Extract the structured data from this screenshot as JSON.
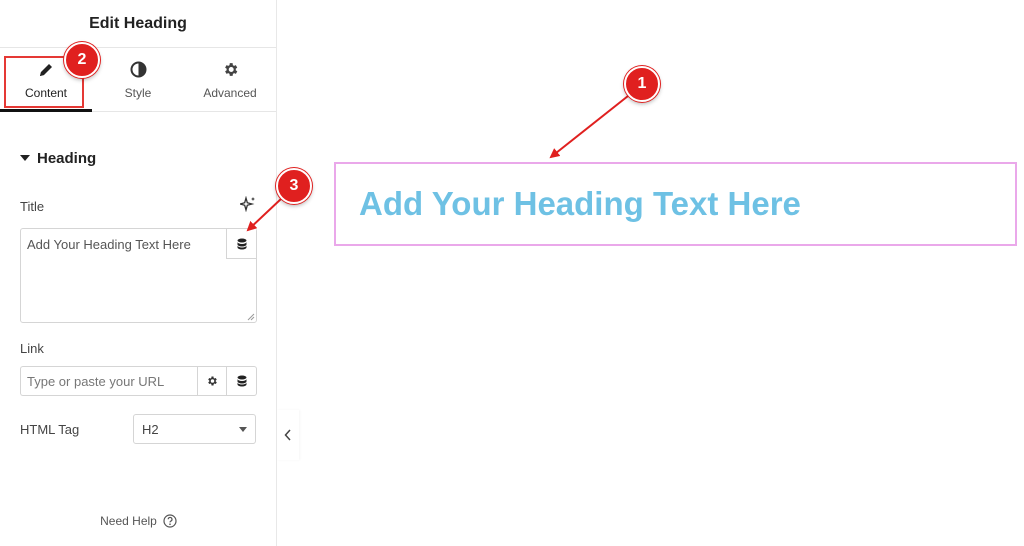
{
  "panel": {
    "title": "Edit Heading",
    "tabs": [
      {
        "label": "Content",
        "icon": "pencil-icon",
        "active": true
      },
      {
        "label": "Style",
        "icon": "half-circle-icon",
        "active": false
      },
      {
        "label": "Advanced",
        "icon": "gear-icon",
        "active": false
      }
    ],
    "section": {
      "label": "Heading",
      "expanded": true
    },
    "title_field": {
      "label": "Title",
      "value": "Add Your Heading Text Here"
    },
    "link_field": {
      "label": "Link",
      "placeholder": "Type or paste your URL",
      "value": ""
    },
    "html_tag": {
      "label": "HTML Tag",
      "selected": "H2"
    },
    "need_help": "Need Help"
  },
  "canvas": {
    "heading_text": "Add Your Heading Text Here",
    "heading_color": "#6ec1e4",
    "selection_border_color": "#eaa8ea"
  },
  "annotations": [
    {
      "number": "1"
    },
    {
      "number": "2"
    },
    {
      "number": "3"
    }
  ],
  "colors": {
    "annotation": "#e0201f",
    "accent": "#111111"
  }
}
